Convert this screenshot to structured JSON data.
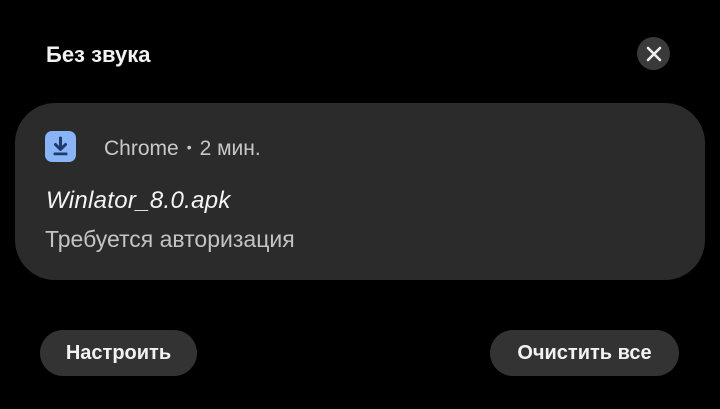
{
  "header": {
    "title": "Без звука",
    "close_icon": "close-icon"
  },
  "notification": {
    "app_icon": "download-icon",
    "app_icon_color": "#8ab4f8",
    "app_name": "Chrome",
    "separator": "•",
    "time": "2 мин.",
    "title": "Winlator_8.0.apk",
    "text": "Требуется авторизация"
  },
  "actions": {
    "configure_label": "Настроить",
    "clear_all_label": "Очистить все"
  }
}
